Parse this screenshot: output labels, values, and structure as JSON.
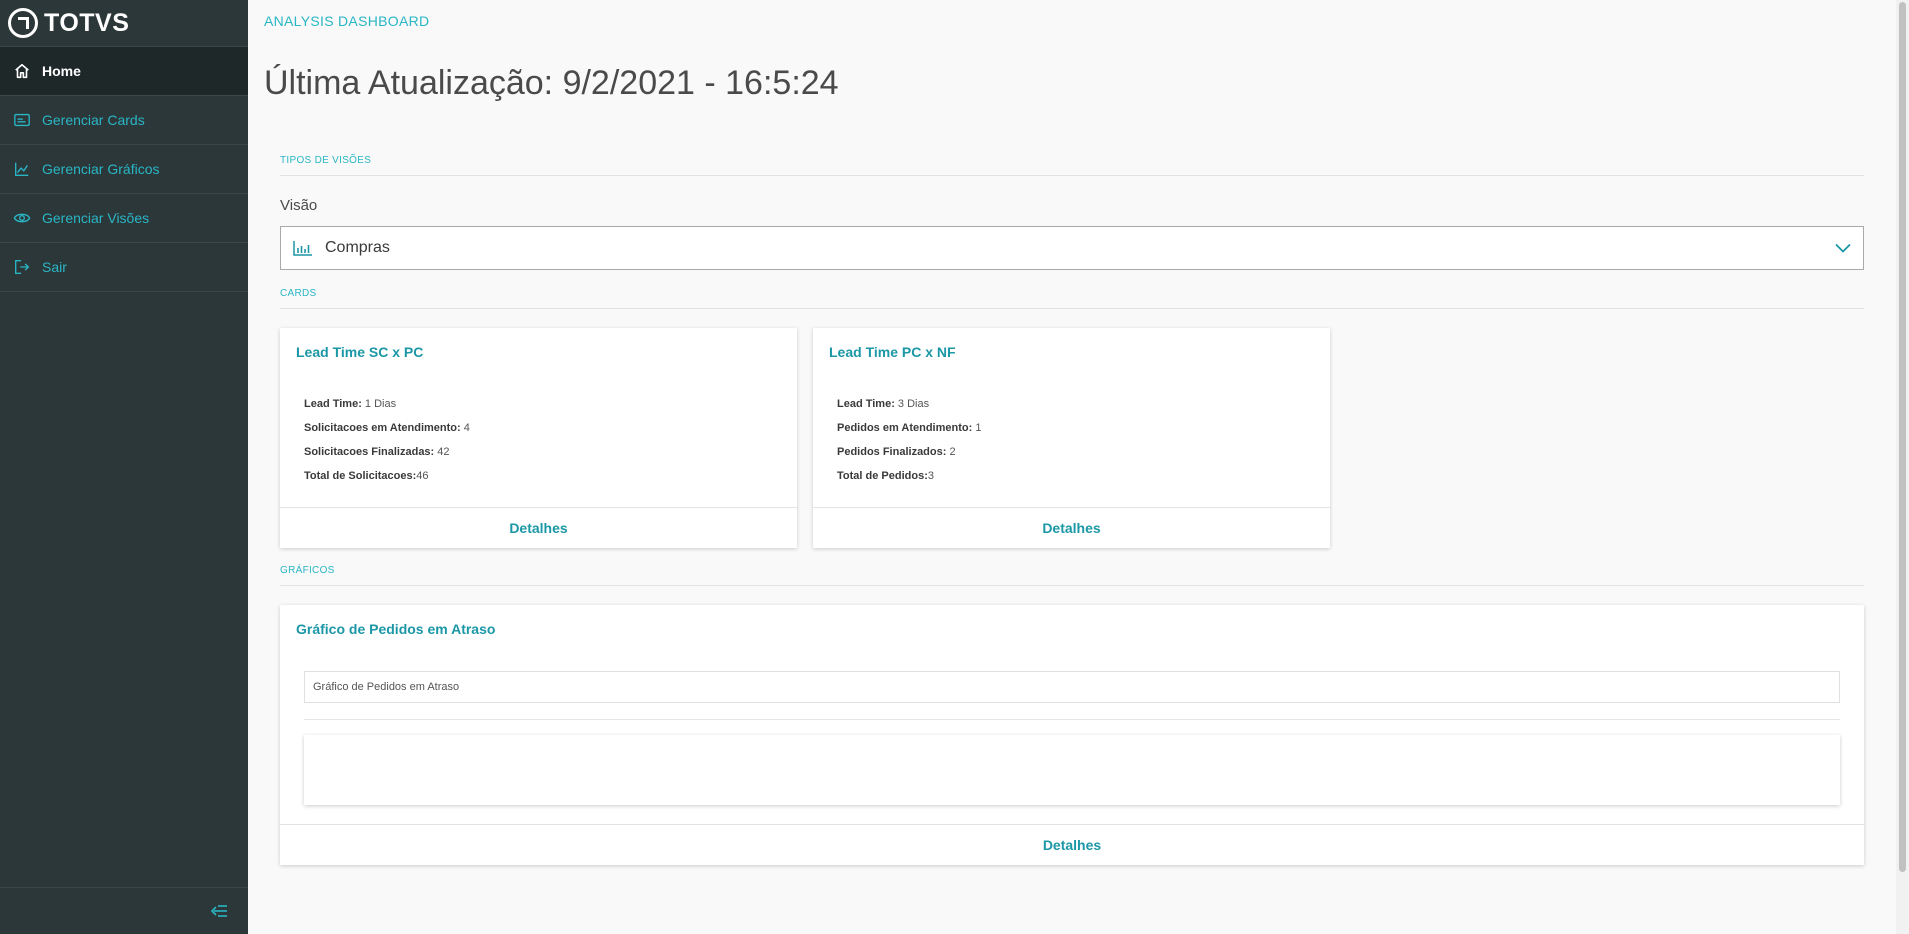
{
  "app": {
    "brand": "TOTVS"
  },
  "sidebar": {
    "items": [
      {
        "label": "Home",
        "icon": "home-icon",
        "active": true
      },
      {
        "label": "Gerenciar Cards",
        "icon": "card-icon"
      },
      {
        "label": "Gerenciar Gráficos",
        "icon": "chart-icon"
      },
      {
        "label": "Gerenciar Visões",
        "icon": "eye-icon"
      },
      {
        "label": "Sair",
        "icon": "logout-icon"
      }
    ]
  },
  "header": {
    "breadcrumb": "ANALYSIS DASHBOARD",
    "title": "Última Atualização: 9/2/2021 - 16:5:24"
  },
  "views": {
    "section": "TIPOS DE VISÕES",
    "field_label": "Visão",
    "selected": "Compras"
  },
  "cards": {
    "section": "CARDS",
    "items": [
      {
        "title": "Lead Time SC x PC",
        "rows": [
          {
            "key": "Lead Time:",
            "value": " 1 Dias"
          },
          {
            "key": "Solicitacoes em Atendimento:",
            "value": " 4"
          },
          {
            "key": "Solicitacoes Finalizadas:",
            "value": " 42"
          },
          {
            "key": "Total de Solicitacoes:",
            "value": "46"
          }
        ],
        "footer": "Detalhes"
      },
      {
        "title": "Lead Time PC x NF",
        "rows": [
          {
            "key": "Lead Time:",
            "value": " 3 Dias"
          },
          {
            "key": "Pedidos em Atendimento:",
            "value": " 1"
          },
          {
            "key": "Pedidos Finalizados:",
            "value": " 2"
          },
          {
            "key": "Total de Pedidos:",
            "value": "3"
          }
        ],
        "footer": "Detalhes"
      }
    ]
  },
  "charts": {
    "section": "GRÁFICOS",
    "card_title": "Gráfico de Pedidos em Atraso",
    "caption": "Gráfico de Pedidos em Atraso",
    "footer": "Detalhes"
  },
  "colors": {
    "sidebar_bg": "#2c3739",
    "accent": "#29b6c5",
    "link": "#1b97a6"
  }
}
